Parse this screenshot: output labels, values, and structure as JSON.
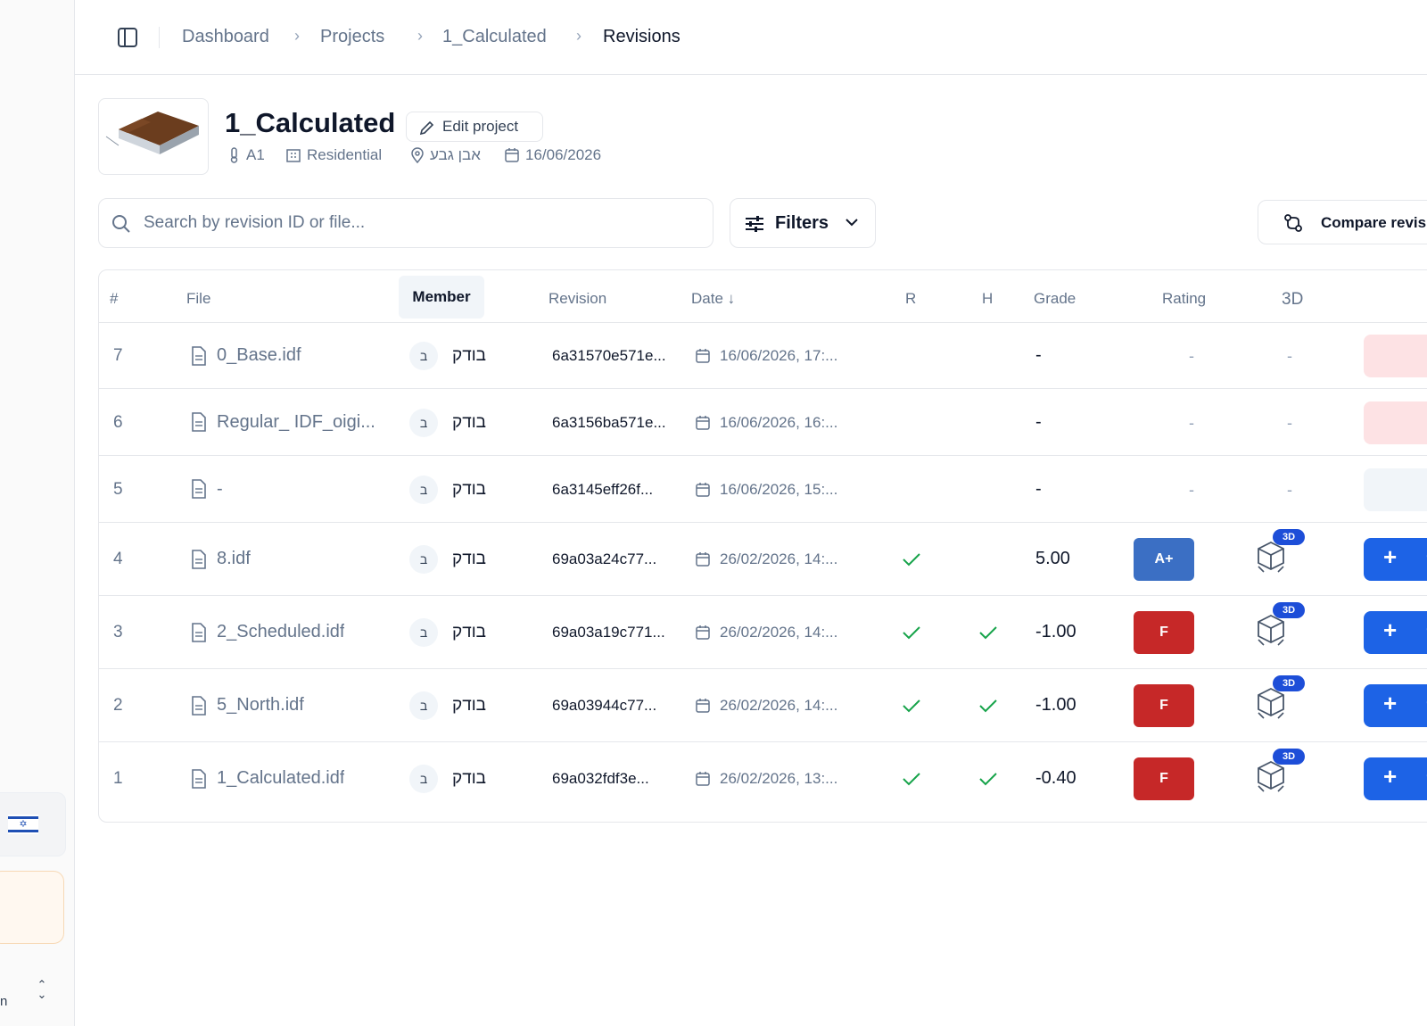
{
  "breadcrumbs": [
    "Dashboard",
    "Projects",
    "1_Calculated",
    "Revisions"
  ],
  "project": {
    "title": "1_Calculated",
    "edit_label": "Edit project",
    "level": "A1",
    "type": "Residential",
    "location": "אבן גבע",
    "date": "16/06/2026"
  },
  "toolbar": {
    "search_placeholder": "Search by revision ID or file...",
    "filters_label": "Filters",
    "compare_label": "Compare revisions"
  },
  "table": {
    "columns": {
      "num": "#",
      "file": "File",
      "member": "Member",
      "revision": "Revision",
      "date": "Date ↓",
      "r": "R",
      "h": "H",
      "grade": "Grade",
      "rating": "Rating",
      "threed": "3D"
    },
    "rows": [
      {
        "num": "7",
        "file": "0_Base.idf",
        "avatar": "ב",
        "member": "בודק",
        "revision": "6a31570e571e...",
        "date": "16/06/2026, 17:...",
        "r": false,
        "h": false,
        "grade": "-",
        "rating": "-",
        "rating_color": "",
        "threed": "-",
        "action": "pink"
      },
      {
        "num": "6",
        "file": "Regular_ IDF_oigi...",
        "avatar": "ב",
        "member": "בודק",
        "revision": "6a3156ba571e...",
        "date": "16/06/2026, 16:...",
        "r": false,
        "h": false,
        "grade": "-",
        "rating": "-",
        "rating_color": "",
        "threed": "-",
        "action": "pink"
      },
      {
        "num": "5",
        "file": "-",
        "avatar": "ב",
        "member": "בודק",
        "revision": "6a3145eff26f...",
        "date": "16/06/2026, 15:...",
        "r": false,
        "h": false,
        "grade": "-",
        "rating": "-",
        "rating_color": "",
        "threed": "-",
        "action": "gray"
      },
      {
        "num": "4",
        "file": "8.idf",
        "avatar": "ב",
        "member": "בודק",
        "revision": "69a03a24c77...",
        "date": "26/02/2026, 14:...",
        "r": true,
        "h": false,
        "grade": "5.00",
        "rating": "A+",
        "rating_color": "#3b6fc4",
        "threed": "3D",
        "action": "blue"
      },
      {
        "num": "3",
        "file": "2_Scheduled.idf",
        "avatar": "ב",
        "member": "בודק",
        "revision": "69a03a19c771...",
        "date": "26/02/2026, 14:...",
        "r": true,
        "h": true,
        "grade": "-1.00",
        "rating": "F",
        "rating_color": "#c62828",
        "threed": "3D",
        "action": "blue"
      },
      {
        "num": "2",
        "file": "5_North.idf",
        "avatar": "ב",
        "member": "בודק",
        "revision": "69a03944c77...",
        "date": "26/02/2026, 14:...",
        "r": true,
        "h": true,
        "grade": "-1.00",
        "rating": "F",
        "rating_color": "#c62828",
        "threed": "3D",
        "action": "blue"
      },
      {
        "num": "1",
        "file": "1_Calculated.idf",
        "avatar": "ב",
        "member": "בודק",
        "revision": "69a032fdf3e...",
        "date": "26/02/2026, 13:...",
        "r": true,
        "h": true,
        "grade": "-0.40",
        "rating": "F",
        "rating_color": "#c62828",
        "threed": "3D",
        "action": "blue"
      }
    ]
  },
  "colors": {
    "accent": "#1d63e6",
    "check": "#16a34a",
    "border": "#e5e7eb",
    "muted_text": "#64748b"
  },
  "icons": {
    "sidebar_toggle": "sidebar-toggle-icon",
    "edit": "pencil-icon",
    "level": "thermometer-icon",
    "type": "building-icon",
    "location": "map-pin-icon",
    "date": "calendar-icon",
    "search": "search-icon",
    "filters": "sliders-icon",
    "compare": "git-compare-icon",
    "file": "file-icon",
    "check": "check-icon",
    "model": "cube-icon",
    "add": "plus-icon",
    "sidebar_expand": "chevrons-up-down-icon"
  }
}
